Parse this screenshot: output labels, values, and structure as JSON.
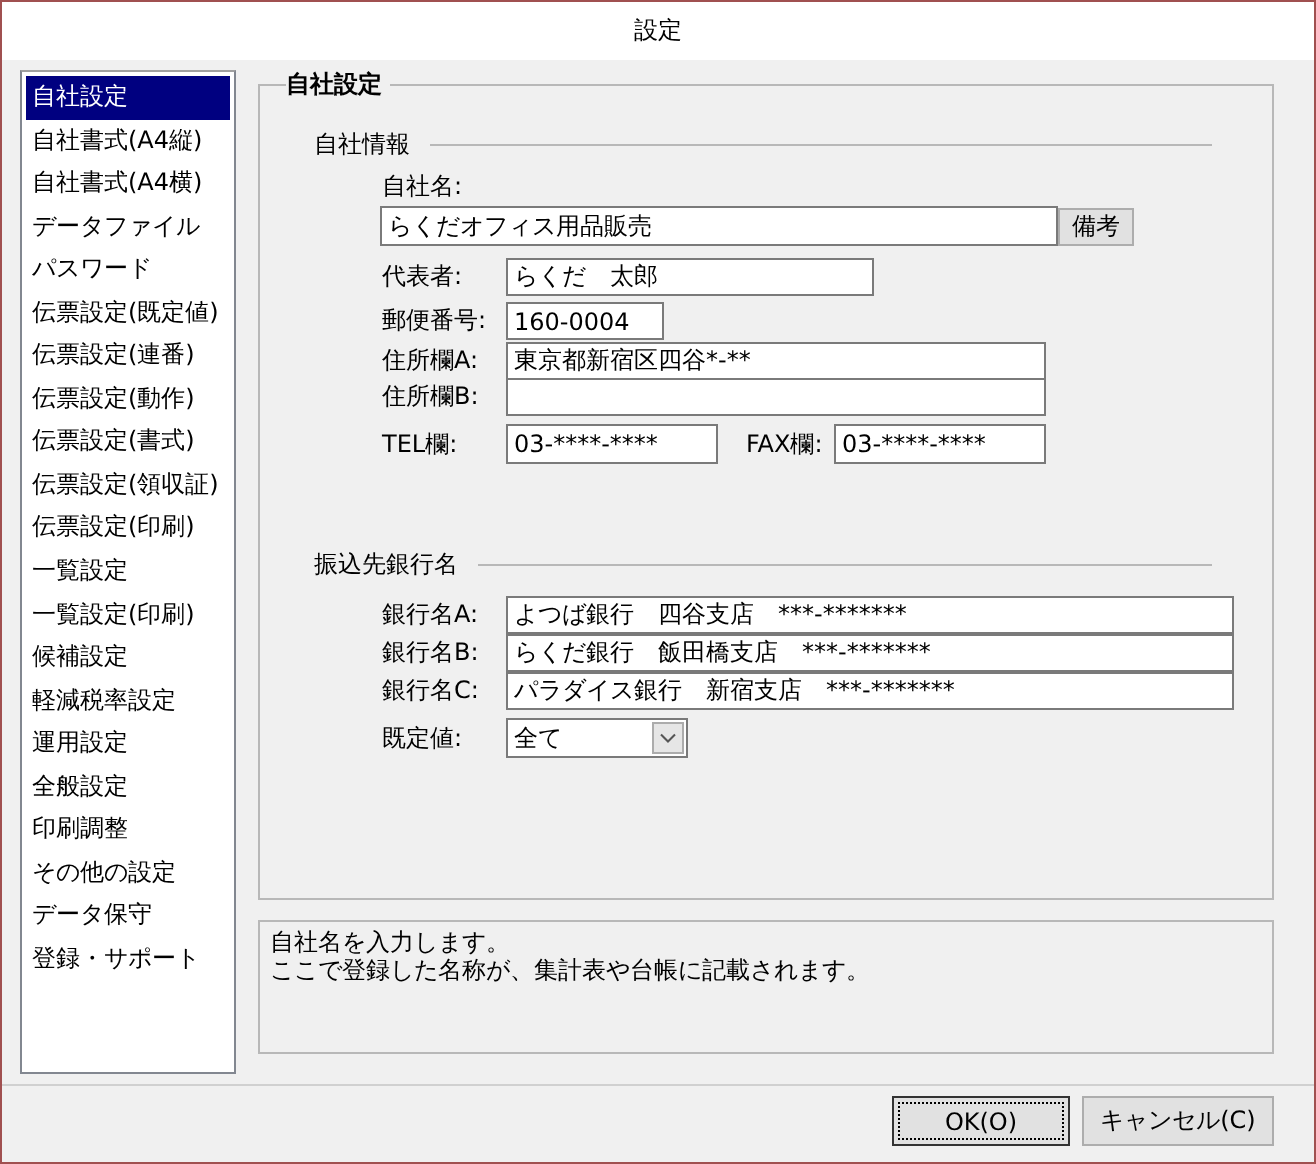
{
  "window": {
    "title": "設定"
  },
  "sidebar": {
    "items": [
      {
        "label": "自社設定",
        "selected": true
      },
      {
        "label": "自社書式(A4縦)",
        "selected": false
      },
      {
        "label": "自社書式(A4横)",
        "selected": false
      },
      {
        "label": "データファイル",
        "selected": false
      },
      {
        "label": "パスワード",
        "selected": false
      },
      {
        "label": "伝票設定(既定値)",
        "selected": false
      },
      {
        "label": "伝票設定(連番)",
        "selected": false
      },
      {
        "label": "伝票設定(動作)",
        "selected": false
      },
      {
        "label": "伝票設定(書式)",
        "selected": false
      },
      {
        "label": "伝票設定(領収証)",
        "selected": false
      },
      {
        "label": "伝票設定(印刷)",
        "selected": false
      },
      {
        "label": "一覧設定",
        "selected": false
      },
      {
        "label": "一覧設定(印刷)",
        "selected": false
      },
      {
        "label": "候補設定",
        "selected": false
      },
      {
        "label": "軽減税率設定",
        "selected": false
      },
      {
        "label": "運用設定",
        "selected": false
      },
      {
        "label": "全般設定",
        "selected": false
      },
      {
        "label": "印刷調整",
        "selected": false
      },
      {
        "label": "その他の設定",
        "selected": false
      },
      {
        "label": "データ保守",
        "selected": false
      },
      {
        "label": "登録・サポート",
        "selected": false
      }
    ]
  },
  "group": {
    "title": "自社設定",
    "company_info": {
      "heading": "自社情報",
      "name": {
        "label": "自社名:",
        "value": "らくだオフィス用品販売",
        "button": "備考"
      },
      "fields": [
        {
          "label": "代表者:",
          "value": "らくだ　太郎",
          "kind": "medium"
        },
        {
          "label": "郵便番号:",
          "value": "160-0004",
          "kind": "short"
        },
        {
          "label": "住所欄A:",
          "value": "東京都新宿区四谷*-**",
          "kind": "long"
        },
        {
          "label": "住所欄B:",
          "kind": "long"
        }
      ],
      "tel": {
        "label": "TEL欄:",
        "value": "03-****-****"
      },
      "fax": {
        "label": "FAX欄:",
        "value": "03-****-****"
      }
    },
    "bank_info": {
      "heading": "振込先銀行名",
      "banks": [
        {
          "label": "銀行名A:",
          "value": "よつば銀行　四谷支店　***-*******"
        },
        {
          "label": "銀行名B:",
          "value": "らくだ銀行　飯田橋支店　***-*******"
        },
        {
          "label": "銀行名C:",
          "value": "パラダイス銀行　新宿支店　***-*******"
        }
      ],
      "default": {
        "label": "既定値:",
        "value": "全て"
      }
    }
  },
  "help": {
    "lines": [
      "自社名を入力します。",
      "ここで登録した名称が、集計表や台帳に記載されます。"
    ]
  },
  "buttons": [
    {
      "label": "OK(O)",
      "focused": true
    },
    {
      "label": "キャンセル(C)",
      "focused": false
    }
  ]
}
